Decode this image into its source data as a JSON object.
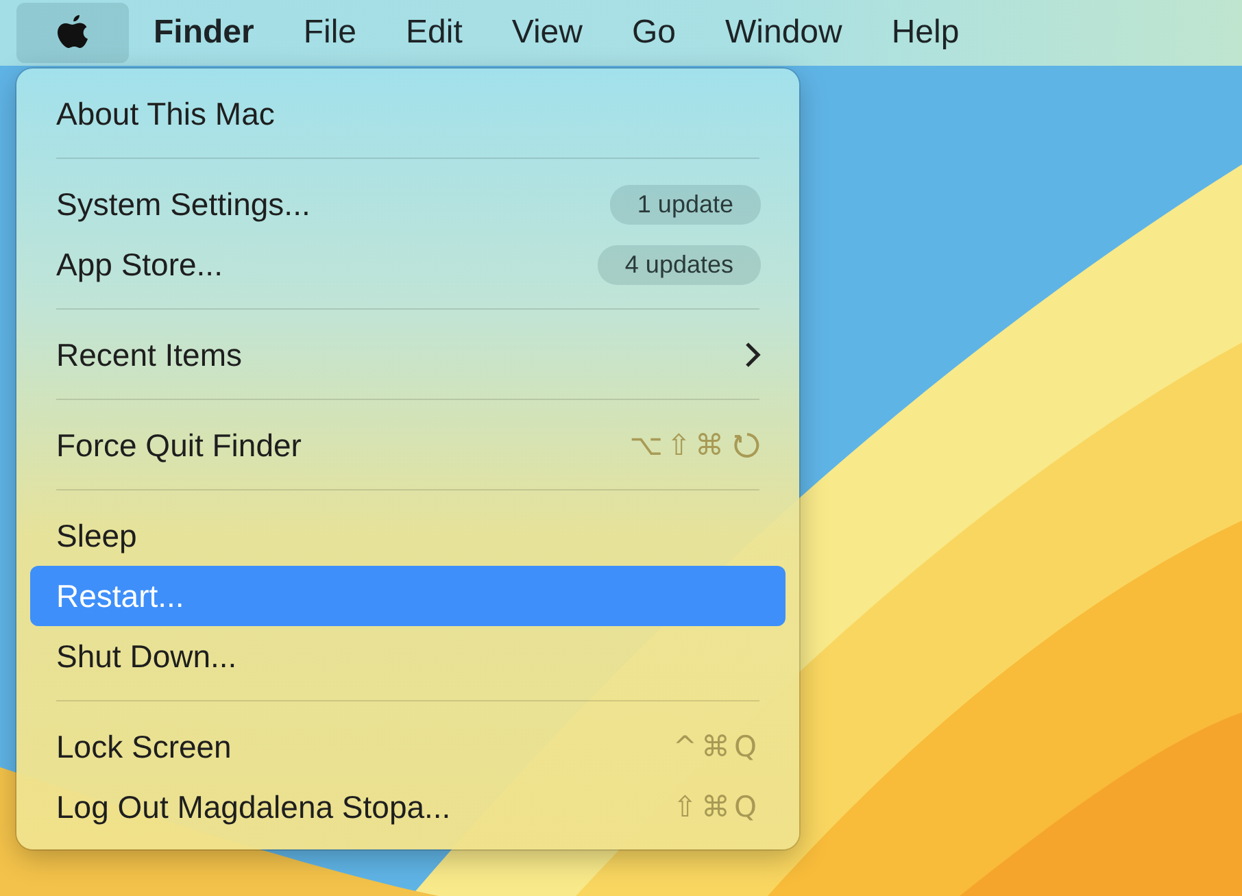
{
  "menu_bar": {
    "items": [
      {
        "label": "Finder",
        "kind": "app",
        "selected": false
      },
      {
        "label": "File",
        "kind": "menu",
        "selected": false
      },
      {
        "label": "Edit",
        "kind": "menu",
        "selected": false
      },
      {
        "label": "View",
        "kind": "menu",
        "selected": false
      },
      {
        "label": "Go",
        "kind": "menu",
        "selected": false
      },
      {
        "label": "Window",
        "kind": "menu",
        "selected": false
      },
      {
        "label": "Help",
        "kind": "menu",
        "selected": false
      }
    ],
    "apple_selected": true
  },
  "menu": {
    "items": [
      {
        "kind": "item",
        "label": "About This Mac",
        "selected": false
      },
      {
        "kind": "separator"
      },
      {
        "kind": "item",
        "label": "System Settings...",
        "badge": "1 update",
        "selected": false
      },
      {
        "kind": "item",
        "label": "App Store...",
        "badge": "4 updates",
        "selected": false
      },
      {
        "kind": "separator"
      },
      {
        "kind": "item",
        "label": "Recent Items",
        "submenu": true,
        "selected": false
      },
      {
        "kind": "separator"
      },
      {
        "kind": "item",
        "label": "Force Quit Finder",
        "shortcut": "⌥⇧⌘",
        "shortcut_power": true,
        "selected": false
      },
      {
        "kind": "separator"
      },
      {
        "kind": "item",
        "label": "Sleep",
        "selected": false
      },
      {
        "kind": "item",
        "label": "Restart...",
        "selected": true
      },
      {
        "kind": "item",
        "label": "Shut Down...",
        "selected": false
      },
      {
        "kind": "separator"
      },
      {
        "kind": "item",
        "label": "Lock Screen",
        "shortcut": "^⌘Q",
        "selected": false
      },
      {
        "kind": "item",
        "label": "Log Out Magdalena Stopa...",
        "shortcut": "⇧⌘Q",
        "selected": false
      }
    ]
  }
}
